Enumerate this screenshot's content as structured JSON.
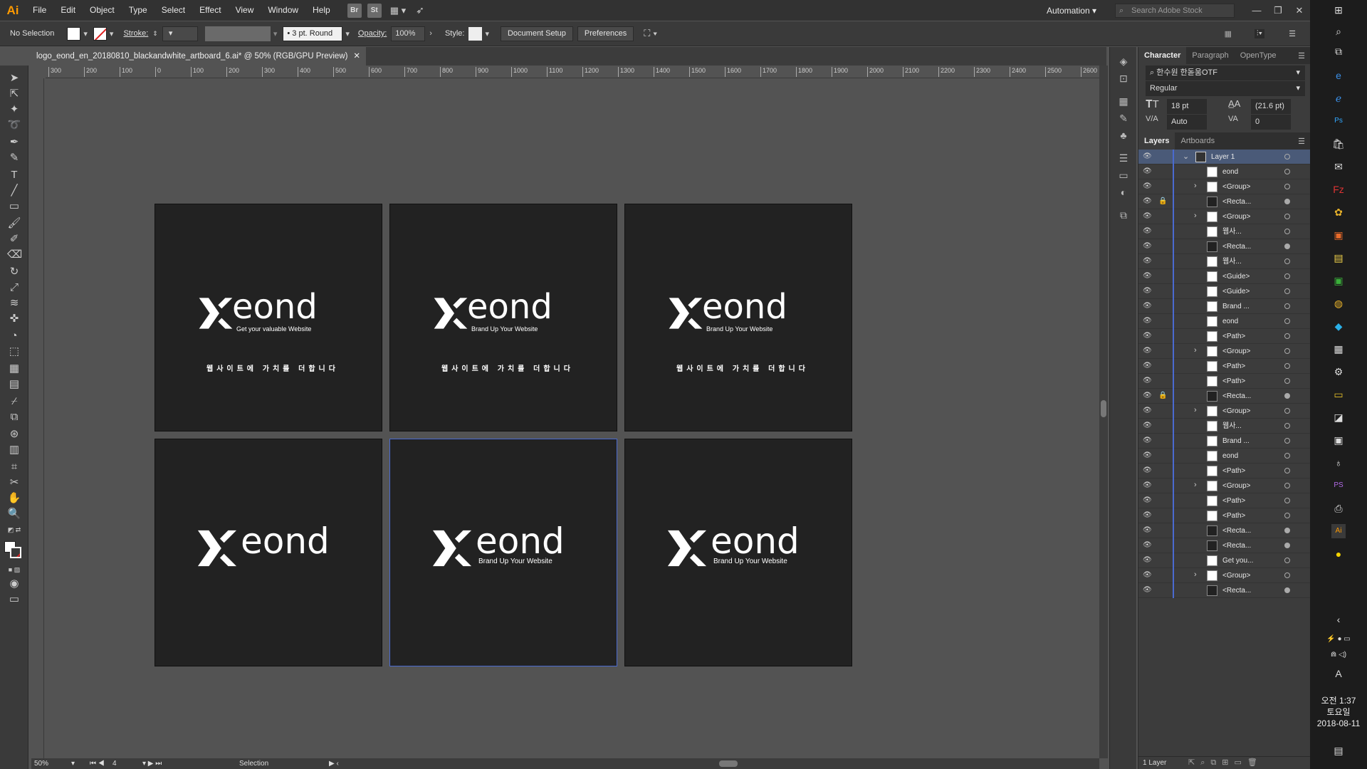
{
  "app": {
    "logo": "Ai"
  },
  "menu": [
    "File",
    "Edit",
    "Object",
    "Type",
    "Select",
    "Effect",
    "View",
    "Window",
    "Help"
  ],
  "menu_icons": {
    "br": "Br",
    "st": "St"
  },
  "workspace": {
    "label": "Automation"
  },
  "stock_search": {
    "placeholder": "Search Adobe Stock"
  },
  "control": {
    "selection": "No Selection",
    "stroke_label": "Stroke:",
    "brush": "3 pt. Round",
    "opacity_label": "Opacity:",
    "opacity_value": "100%",
    "style_label": "Style:",
    "document_setup": "Document Setup",
    "preferences": "Preferences"
  },
  "document": {
    "tab_title": "logo_eond_en_20180810_blackandwhite_artboard_6.ai* @ 50% (RGB/GPU Preview)"
  },
  "ruler": {
    "top": [
      "300",
      "200",
      "100",
      "0",
      "100",
      "200",
      "300",
      "400",
      "500",
      "600",
      "700",
      "800",
      "900",
      "1000",
      "1100",
      "1200",
      "1300",
      "1400",
      "1500",
      "1600",
      "1700",
      "1800",
      "1900",
      "2000",
      "2100",
      "2200",
      "2300",
      "2400",
      "2500",
      "2600"
    ]
  },
  "artboards": [
    {
      "word": "eond",
      "tagline": "Get your valuable Website",
      "korean": "웹사이트에 가치를 더합니다"
    },
    {
      "word": "eond",
      "tagline": "Brand Up Your Website",
      "korean": "웹사이트에 가치를 더합니다"
    },
    {
      "word": "eond",
      "tagline": "Brand Up Your Website",
      "korean": "웹사이트에 가치를 더합니다"
    },
    {
      "word": "eond",
      "tagline": "",
      "korean": ""
    },
    {
      "word": "eond",
      "tagline": "Brand Up Your Website",
      "korean": ""
    },
    {
      "word": "eond",
      "tagline": "Brand Up Your Website",
      "korean": ""
    }
  ],
  "status": {
    "zoom": "50%",
    "artboard_num": "4",
    "tool": "Selection"
  },
  "character": {
    "tabs": [
      "Character",
      "Paragraph",
      "OpenType"
    ],
    "font": "한수원 한돋움OTF",
    "style": "Regular",
    "size": "18 pt",
    "leading": "(21.6 pt)",
    "kerning": "Auto",
    "tracking": "0"
  },
  "layers_panel": {
    "tabs": [
      "Layers",
      "Artboards"
    ],
    "layer_count": "1 Layer",
    "rows": [
      {
        "name": "Layer 1",
        "chev": "v",
        "thumb": "layer",
        "lock": false,
        "circ": false
      },
      {
        "name": "eond",
        "chev": "",
        "thumb": "light",
        "lock": false,
        "circ": false
      },
      {
        "name": "<Group>",
        "chev": ">",
        "thumb": "light",
        "lock": false,
        "circ": false
      },
      {
        "name": "<Recta...",
        "chev": "",
        "thumb": "dark",
        "lock": true,
        "circ": true
      },
      {
        "name": "<Group>",
        "chev": ">",
        "thumb": "light",
        "lock": false,
        "circ": false
      },
      {
        "name": "웹사...",
        "chev": "",
        "thumb": "light",
        "lock": false,
        "circ": false
      },
      {
        "name": "<Recta...",
        "chev": "",
        "thumb": "dark",
        "lock": false,
        "circ": true
      },
      {
        "name": "웹사...",
        "chev": "",
        "thumb": "light",
        "lock": false,
        "circ": false
      },
      {
        "name": "<Guide>",
        "chev": "",
        "thumb": "light",
        "lock": false,
        "circ": false
      },
      {
        "name": "<Guide>",
        "chev": "",
        "thumb": "light",
        "lock": false,
        "circ": false
      },
      {
        "name": "Brand ...",
        "chev": "",
        "thumb": "light",
        "lock": false,
        "circ": false
      },
      {
        "name": "eond",
        "chev": "",
        "thumb": "light",
        "lock": false,
        "circ": false
      },
      {
        "name": "<Path>",
        "chev": "",
        "thumb": "light",
        "lock": false,
        "circ": false
      },
      {
        "name": "<Group>",
        "chev": ">",
        "thumb": "light",
        "lock": false,
        "circ": false
      },
      {
        "name": "<Path>",
        "chev": "",
        "thumb": "light",
        "lock": false,
        "circ": false
      },
      {
        "name": "<Path>",
        "chev": "",
        "thumb": "light",
        "lock": false,
        "circ": false
      },
      {
        "name": "<Recta...",
        "chev": "",
        "thumb": "dark",
        "lock": true,
        "circ": true
      },
      {
        "name": "<Group>",
        "chev": ">",
        "thumb": "light",
        "lock": false,
        "circ": false
      },
      {
        "name": "웹사...",
        "chev": "",
        "thumb": "light",
        "lock": false,
        "circ": false
      },
      {
        "name": "Brand ...",
        "chev": "",
        "thumb": "light",
        "lock": false,
        "circ": false
      },
      {
        "name": "eond",
        "chev": "",
        "thumb": "light",
        "lock": false,
        "circ": false
      },
      {
        "name": "<Path>",
        "chev": "",
        "thumb": "light",
        "lock": false,
        "circ": false
      },
      {
        "name": "<Group>",
        "chev": ">",
        "thumb": "light",
        "lock": false,
        "circ": false
      },
      {
        "name": "<Path>",
        "chev": "",
        "thumb": "light",
        "lock": false,
        "circ": false
      },
      {
        "name": "<Path>",
        "chev": "",
        "thumb": "light",
        "lock": false,
        "circ": false
      },
      {
        "name": "<Recta...",
        "chev": "",
        "thumb": "dark",
        "lock": false,
        "circ": true
      },
      {
        "name": "<Recta...",
        "chev": "",
        "thumb": "dark",
        "lock": false,
        "circ": true
      },
      {
        "name": "Get you...",
        "chev": "",
        "thumb": "light",
        "lock": false,
        "circ": false
      },
      {
        "name": "<Group>",
        "chev": ">",
        "thumb": "light",
        "lock": false,
        "circ": false
      },
      {
        "name": "<Recta...",
        "chev": "",
        "thumb": "dark",
        "lock": false,
        "circ": true
      }
    ]
  },
  "taskbar": {
    "time": "오전 1:37",
    "day": "토요일",
    "date": "2018-08-11",
    "ime": "A"
  },
  "colors": {
    "accent": "#ff9a00",
    "selection": "#4a6ad0",
    "artboard": "#222222"
  }
}
